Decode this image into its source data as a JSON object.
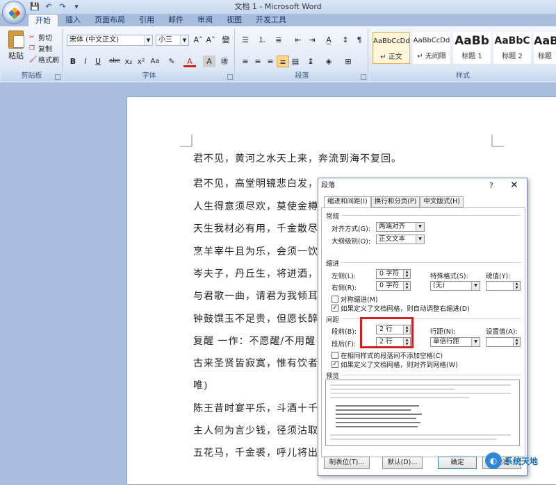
{
  "window": {
    "title": "文档 1 - Microsoft Word",
    "qat_icons": [
      "save-icon",
      "undo-icon",
      "redo-icon"
    ]
  },
  "tabs": [
    "开始",
    "插入",
    "页面布局",
    "引用",
    "邮件",
    "审阅",
    "视图",
    "开发工具"
  ],
  "ribbon": {
    "clipboard": {
      "paste": "粘贴",
      "cut": "剪切",
      "copy": "复制",
      "format_painter": "格式刷",
      "label": "剪贴板"
    },
    "font": {
      "font_name": "宋体 (中文正文)",
      "font_size": "小三",
      "label": "字体",
      "buttons": [
        "B",
        "I",
        "U",
        "abc",
        "x₂",
        "x²",
        "Aa",
        "A",
        "A"
      ]
    },
    "paragraph": {
      "label": "段落"
    },
    "styles": {
      "label": "样式",
      "items": [
        {
          "sample": "AaBbCcDd",
          "name": "↵ 正文"
        },
        {
          "sample": "AaBbCcDd",
          "name": "↵ 无间隔"
        },
        {
          "sample": "AaBb",
          "name": "标题 1"
        },
        {
          "sample": "AaBbC",
          "name": "标题 2"
        },
        {
          "sample": "AaBb",
          "name": "标题"
        }
      ]
    }
  },
  "document": {
    "lines": [
      "君不见，黄河之水天上来，奔流到海不复回。",
      "君不见，高堂明镜悲白发，",
      "人生得意须尽欢，莫使金樽",
      "天生我材必有用，千金散尽",
      "烹羊宰牛且为乐，会须一饮",
      "岑夫子，丹丘生，将进酒，",
      "与君歌一曲，请君为我倾耳",
      "钟鼓馔玉不足贵，但愿长醉",
      "复醒 一作：不愿醒/不用醒",
      "古来圣贤皆寂寞，惟有饮者",
      "唯)",
      "陈王昔时宴平乐，斗酒十千",
      "主人何为言少钱，径须沽取",
      "五花马，千金裘，呼儿将出"
    ]
  },
  "dialog": {
    "title": "段落",
    "help": "?",
    "close": "✕",
    "tabs": [
      "缩进和间距(I)",
      "换行和分页(P)",
      "中文版式(H)"
    ],
    "general": {
      "section": "常规",
      "alignment_label": "对齐方式(G):",
      "alignment_value": "两端对齐",
      "outline_label": "大纲级别(O):",
      "outline_value": "正文文本"
    },
    "indent": {
      "section": "缩进",
      "left_label": "左侧(L):",
      "left_value": "0 字符",
      "right_label": "右侧(R):",
      "right_value": "0 字符",
      "special_label": "特殊格式(S):",
      "special_value": "(无)",
      "by_label": "磅值(Y):",
      "by_value": "",
      "mirror_label": "对称缩进(M)",
      "auto_adjust_label": "如果定义了文档网格，则自动调整右缩进(D)"
    },
    "spacing": {
      "section": "间距",
      "before_label": "段前(B):",
      "before_value": "2 行",
      "after_label": "段后(F):",
      "after_value": "2 行",
      "line_label": "行距(N):",
      "line_value": "单倍行距",
      "at_label": "设置值(A):",
      "at_value": "",
      "no_space_label": "在相同样式的段落间不添加空格(C)",
      "snap_grid_label": "如果定义了文档网格，则对齐到网格(W)"
    },
    "preview": {
      "section": "预览"
    },
    "buttons": {
      "tabs": "制表位(T)...",
      "default": "默认(D)...",
      "ok": "确定",
      "cancel": "取消"
    }
  },
  "watermark": {
    "text": "系统天地"
  },
  "colors": {
    "highlight_box": "#d11f1f",
    "ribbon": "#dbe6f5",
    "workspace": "#a9bedd"
  }
}
